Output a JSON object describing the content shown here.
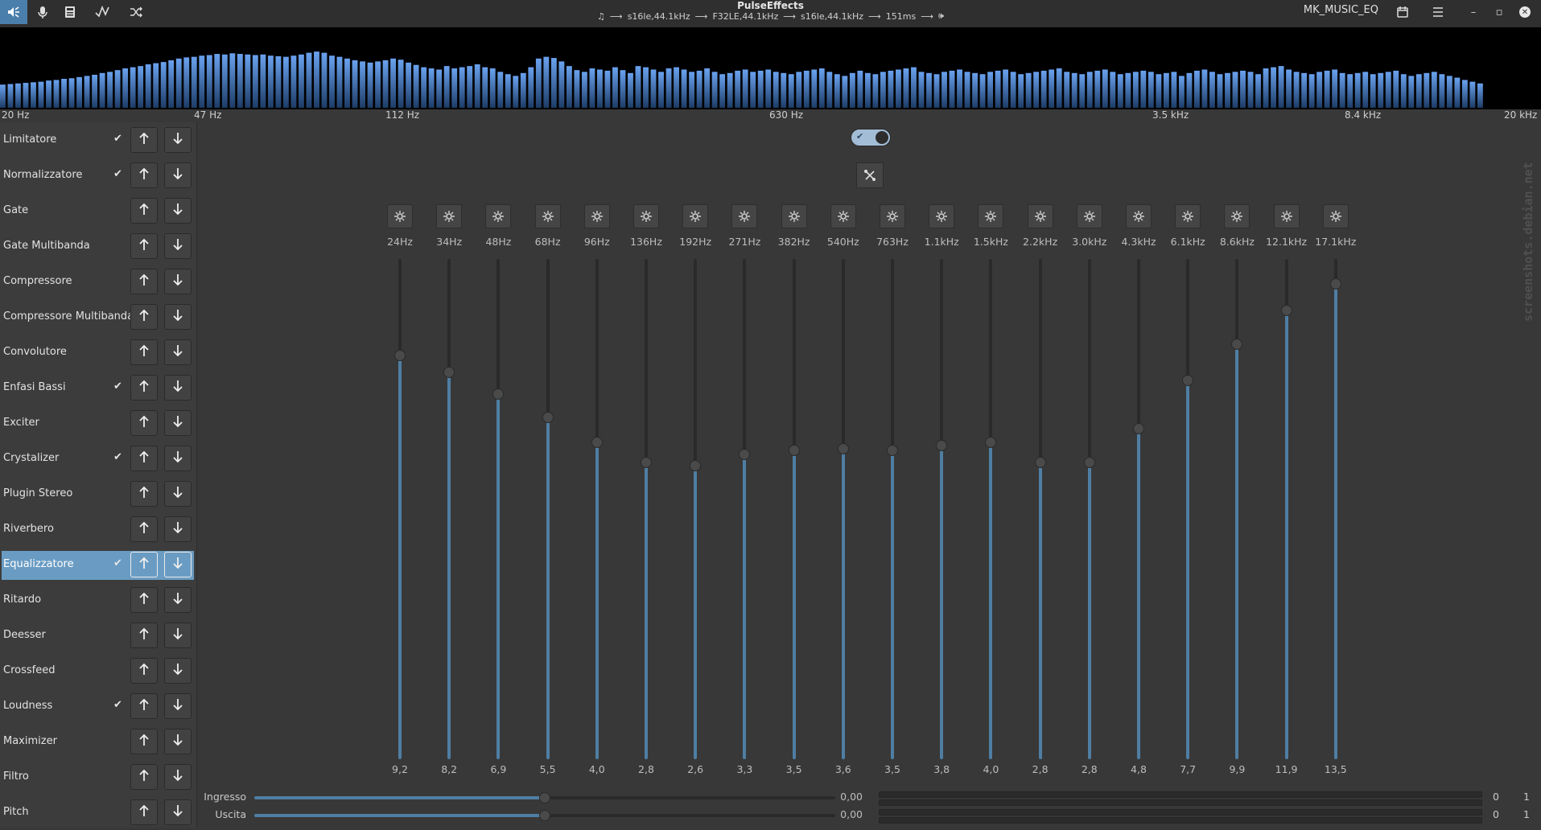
{
  "app": {
    "title": "PulseEffects",
    "pipeline": [
      "s16le,44.1kHz",
      "F32LE,44.1kHz",
      "s16le,44.1kHz",
      "151ms"
    ],
    "preset_name": "MK_MUSIC_EQ",
    "toolbar_icons": [
      "speaker-output-icon",
      "microphone-icon",
      "calculator-icon",
      "waveform-icon",
      "shuffle-icon"
    ]
  },
  "colors": {
    "accent": "#4f7ea3",
    "selection": "#6a9cc3",
    "spectrum_bar": "#5b8fd6"
  },
  "spectrum": {
    "labels": [
      "20 Hz",
      "47 Hz",
      "112 Hz",
      "630 Hz",
      "3.5 kHz",
      "8.4 kHz",
      "20 kHz"
    ],
    "levels": [
      0.4,
      0.41,
      0.42,
      0.43,
      0.44,
      0.45,
      0.47,
      0.48,
      0.5,
      0.51,
      0.53,
      0.55,
      0.57,
      0.6,
      0.62,
      0.65,
      0.68,
      0.7,
      0.72,
      0.75,
      0.77,
      0.79,
      0.82,
      0.85,
      0.87,
      0.88,
      0.9,
      0.91,
      0.93,
      0.92,
      0.94,
      0.93,
      0.92,
      0.91,
      0.92,
      0.9,
      0.89,
      0.88,
      0.9,
      0.92,
      0.95,
      0.97,
      0.95,
      0.9,
      0.88,
      0.85,
      0.82,
      0.8,
      0.78,
      0.8,
      0.82,
      0.85,
      0.83,
      0.78,
      0.74,
      0.7,
      0.68,
      0.66,
      0.72,
      0.68,
      0.7,
      0.72,
      0.75,
      0.7,
      0.68,
      0.62,
      0.58,
      0.55,
      0.6,
      0.7,
      0.85,
      0.88,
      0.86,
      0.8,
      0.72,
      0.65,
      0.62,
      0.68,
      0.66,
      0.64,
      0.7,
      0.65,
      0.6,
      0.72,
      0.7,
      0.66,
      0.62,
      0.68,
      0.7,
      0.66,
      0.62,
      0.64,
      0.68,
      0.62,
      0.58,
      0.6,
      0.64,
      0.66,
      0.62,
      0.64,
      0.66,
      0.62,
      0.6,
      0.58,
      0.62,
      0.64,
      0.66,
      0.68,
      0.62,
      0.58,
      0.55,
      0.6,
      0.64,
      0.6,
      0.58,
      0.62,
      0.64,
      0.66,
      0.68,
      0.7,
      0.62,
      0.6,
      0.58,
      0.62,
      0.64,
      0.66,
      0.62,
      0.6,
      0.58,
      0.62,
      0.64,
      0.66,
      0.62,
      0.58,
      0.6,
      0.62,
      0.64,
      0.66,
      0.68,
      0.62,
      0.6,
      0.58,
      0.62,
      0.64,
      0.66,
      0.62,
      0.58,
      0.6,
      0.62,
      0.64,
      0.62,
      0.58,
      0.6,
      0.62,
      0.55,
      0.6,
      0.64,
      0.66,
      0.62,
      0.58,
      0.6,
      0.62,
      0.64,
      0.62,
      0.58,
      0.68,
      0.7,
      0.72,
      0.66,
      0.62,
      0.6,
      0.58,
      0.62,
      0.64,
      0.66,
      0.6,
      0.58,
      0.6,
      0.62,
      0.58,
      0.6,
      0.62,
      0.64,
      0.58,
      0.55,
      0.58,
      0.6,
      0.62,
      0.58,
      0.55,
      0.52,
      0.48,
      0.45,
      0.42,
      0.0
    ]
  },
  "plugins": [
    {
      "name": "Limitatore",
      "enabled": true,
      "selected": false
    },
    {
      "name": "Normalizzatore",
      "enabled": true,
      "selected": false
    },
    {
      "name": "Gate",
      "enabled": false,
      "selected": false
    },
    {
      "name": "Gate Multibanda",
      "enabled": false,
      "selected": false
    },
    {
      "name": "Compressore",
      "enabled": false,
      "selected": false
    },
    {
      "name": "Compressore Multibanda",
      "enabled": false,
      "selected": false
    },
    {
      "name": "Convolutore",
      "enabled": false,
      "selected": false
    },
    {
      "name": "Enfasi Bassi",
      "enabled": true,
      "selected": false
    },
    {
      "name": "Exciter",
      "enabled": false,
      "selected": false
    },
    {
      "name": "Crystalizer",
      "enabled": true,
      "selected": false
    },
    {
      "name": "Plugin Stereo",
      "enabled": false,
      "selected": false
    },
    {
      "name": "Riverbero",
      "enabled": false,
      "selected": false
    },
    {
      "name": "Equalizzatore",
      "enabled": true,
      "selected": true
    },
    {
      "name": "Ritardo",
      "enabled": false,
      "selected": false
    },
    {
      "name": "Deesser",
      "enabled": false,
      "selected": false
    },
    {
      "name": "Crossfeed",
      "enabled": false,
      "selected": false
    },
    {
      "name": "Loudness",
      "enabled": true,
      "selected": false
    },
    {
      "name": "Maximizer",
      "enabled": false,
      "selected": false
    },
    {
      "name": "Filtro",
      "enabled": false,
      "selected": false
    },
    {
      "name": "Pitch",
      "enabled": false,
      "selected": false
    }
  ],
  "equalizer": {
    "enabled": true,
    "slider_range": [
      -15,
      15
    ],
    "bands": [
      {
        "freq": "24Hz",
        "gain": "9,2"
      },
      {
        "freq": "34Hz",
        "gain": "8,2"
      },
      {
        "freq": "48Hz",
        "gain": "6,9"
      },
      {
        "freq": "68Hz",
        "gain": "5,5"
      },
      {
        "freq": "96Hz",
        "gain": "4,0"
      },
      {
        "freq": "136Hz",
        "gain": "2,8"
      },
      {
        "freq": "192Hz",
        "gain": "2,6"
      },
      {
        "freq": "271Hz",
        "gain": "3,3"
      },
      {
        "freq": "382Hz",
        "gain": "3,5"
      },
      {
        "freq": "540Hz",
        "gain": "3,6"
      },
      {
        "freq": "763Hz",
        "gain": "3,5"
      },
      {
        "freq": "1.1kHz",
        "gain": "3,8"
      },
      {
        "freq": "1.5kHz",
        "gain": "4,0"
      },
      {
        "freq": "2.2kHz",
        "gain": "2,8"
      },
      {
        "freq": "3.0kHz",
        "gain": "2,8"
      },
      {
        "freq": "4.3kHz",
        "gain": "4,8"
      },
      {
        "freq": "6.1kHz",
        "gain": "7,7"
      },
      {
        "freq": "8.6kHz",
        "gain": "9,9"
      },
      {
        "freq": "12.1kHz",
        "gain": "11,9"
      },
      {
        "freq": "17.1kHz",
        "gain": "13,5"
      }
    ]
  },
  "levels": {
    "input": {
      "label": "Ingresso",
      "value": "0,00",
      "left": "0",
      "right": "1"
    },
    "output": {
      "label": "Uscita",
      "value": "0,00",
      "left": "0",
      "right": "1"
    }
  },
  "watermark": "screenshots.debian.net"
}
